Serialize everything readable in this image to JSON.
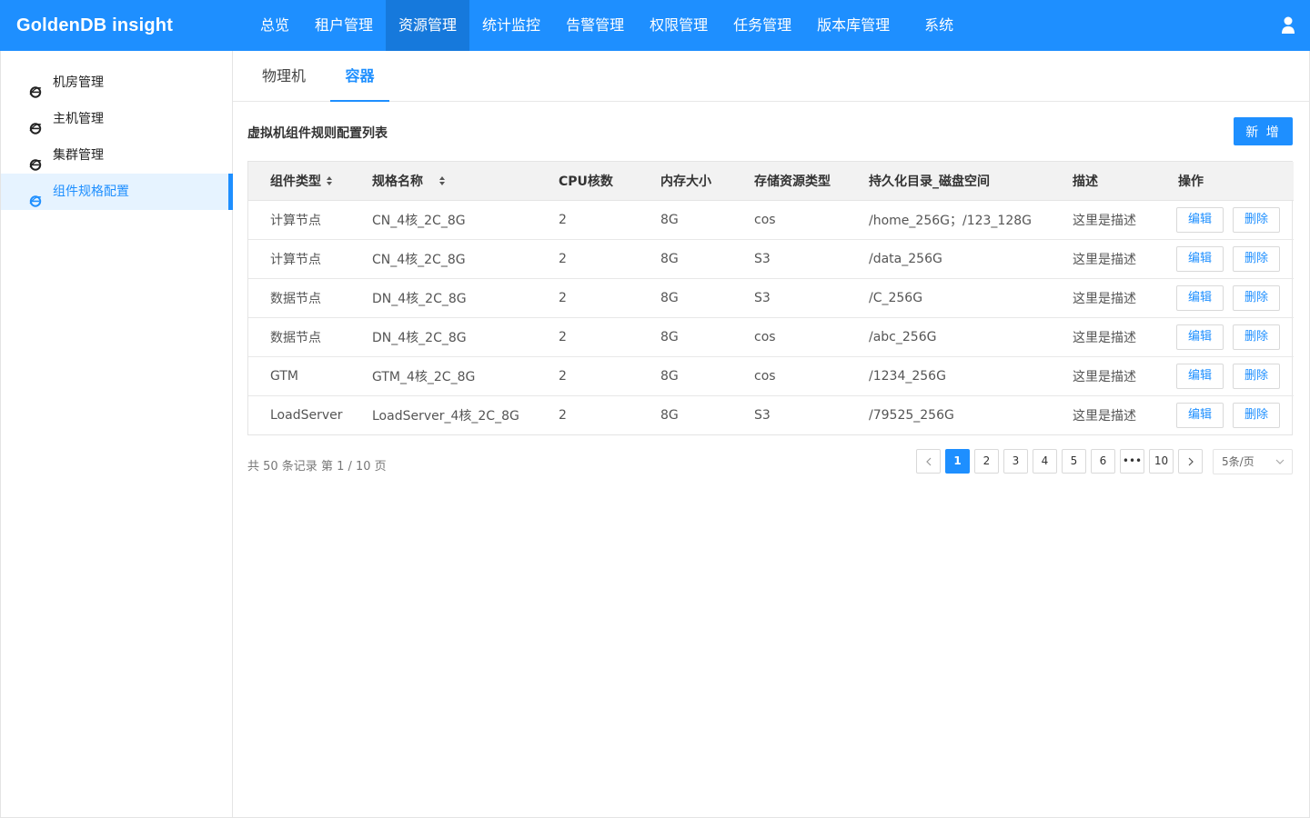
{
  "app": {
    "brand": "GoldenDB insight"
  },
  "nav": {
    "items": [
      {
        "label": "总览",
        "active": false
      },
      {
        "label": "租户管理",
        "active": false
      },
      {
        "label": "资源管理",
        "active": true
      },
      {
        "label": "统计监控",
        "active": false
      },
      {
        "label": "告警管理",
        "active": false
      },
      {
        "label": "权限管理",
        "active": false
      },
      {
        "label": "任务管理",
        "active": false
      },
      {
        "label": "版本库管理",
        "active": false
      },
      {
        "label": "系统",
        "active": false
      }
    ],
    "user_icon": "user-icon"
  },
  "sidebar": {
    "items": [
      {
        "label": "机房管理",
        "icon": "ie-icon",
        "active": false
      },
      {
        "label": "主机管理",
        "icon": "ie-icon",
        "active": false
      },
      {
        "label": "集群管理",
        "icon": "ie-icon",
        "active": false
      },
      {
        "label": "组件规格配置",
        "icon": "ie-icon",
        "active": true
      }
    ]
  },
  "tabs": [
    {
      "label": "物理机",
      "active": false
    },
    {
      "label": "容器",
      "active": true
    }
  ],
  "section": {
    "title": "虚拟机组件规则配置列表",
    "add_label": "新 增"
  },
  "table": {
    "columns": [
      "组件类型",
      "规格名称",
      "CPU核数",
      "内存大小",
      "存储资源类型",
      "持久化目录_磁盘空间",
      "描述",
      "操作"
    ],
    "sortable": [
      true,
      true,
      false,
      false,
      false,
      false,
      false,
      false
    ],
    "rows": [
      {
        "type": "计算节点",
        "spec": "CN_4核_2C_8G",
        "cpu": "2",
        "mem": "8G",
        "storage": "cos",
        "dir": "/home_256G；/123_128G",
        "desc": "这里是描述"
      },
      {
        "type": "计算节点",
        "spec": "CN_4核_2C_8G",
        "cpu": "2",
        "mem": "8G",
        "storage": "S3",
        "dir": "/data_256G",
        "desc": "这里是描述"
      },
      {
        "type": "数据节点",
        "spec": "DN_4核_2C_8G",
        "cpu": "2",
        "mem": "8G",
        "storage": "S3",
        "dir": "/C_256G",
        "desc": "这里是描述"
      },
      {
        "type": "数据节点",
        "spec": "DN_4核_2C_8G",
        "cpu": "2",
        "mem": "8G",
        "storage": "cos",
        "dir": "/abc_256G",
        "desc": "这里是描述"
      },
      {
        "type": "GTM",
        "spec": "GTM_4核_2C_8G",
        "cpu": "2",
        "mem": "8G",
        "storage": "cos",
        "dir": "/1234_256G",
        "desc": "这里是描述"
      },
      {
        "type": "LoadServer",
        "spec": "LoadServer_4核_2C_8G",
        "cpu": "2",
        "mem": "8G",
        "storage": "S3",
        "dir": "/79525_256G",
        "desc": "这里是描述"
      }
    ],
    "edit_label": "编辑",
    "delete_label": "删除"
  },
  "pagination": {
    "summary": "共 50 条记录 第 1 / 10 页",
    "pages": [
      "1",
      "2",
      "3",
      "4",
      "5",
      "6",
      "•••",
      "10"
    ],
    "current": "1",
    "page_size": "5条/页"
  },
  "colors": {
    "primary": "#1e8fff",
    "nav_active": "#1679dc",
    "sidebar_active_bg": "#e6f3ff"
  }
}
